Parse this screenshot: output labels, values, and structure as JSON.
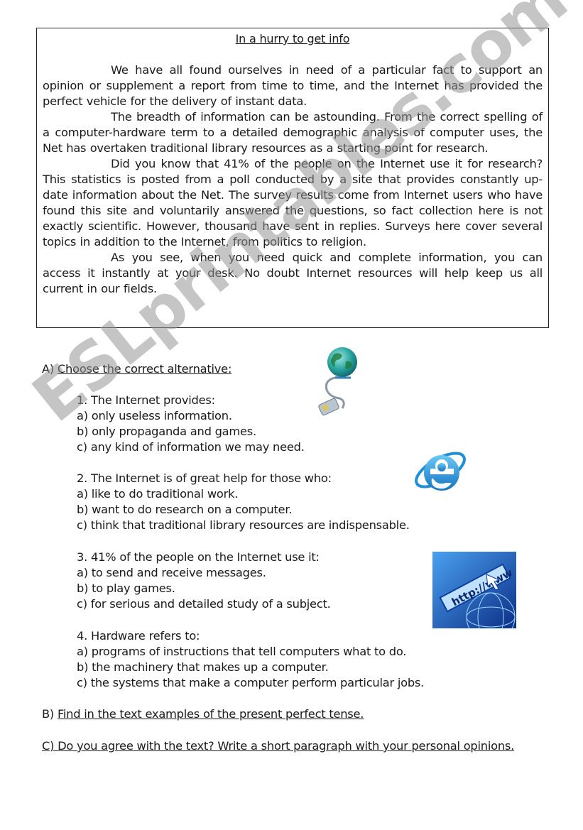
{
  "reading": {
    "title": "In a hurry to get info",
    "paragraphs": [
      "We have all found ourselves in need of a particular fact to support an opinion or supplement a report from time to time, and the Internet has provided the perfect vehicle for the delivery of instant data.",
      "The breadth of information can be astounding. From the correct spelling of a computer-hardware term to a detailed demographic analysis of computer uses, the Net has overtaken traditional library resources as a starting point for research.",
      "Did you know that 41% of the people on the Internet use it for research? This statistics is posted from a poll conducted by a site that provides constantly up-date information about the Net. The survey results come from Internet users who have found this site and voluntarily answered the questions, so fact collection here is not exactly scientific. However, thousand have sent in replies. Surveys here cover several topics in addition to the Internet, from politics to religion.",
      "As you see, when you need quick and complete information, you can access it instantly at your desk. No doubt Internet resources will help keep us all current in our fields."
    ]
  },
  "section_a": {
    "prefix": "A) ",
    "heading": "Choose the correct alternative:",
    "questions": [
      {
        "stem": "1. The Internet provides:",
        "options": [
          "a) only useless information.",
          "b) only propaganda and games.",
          "c) any kind of information we may need."
        ]
      },
      {
        "stem": "2. The Internet is of great help for those who:",
        "options": [
          "a) like to do traditional work.",
          "b) want to do research on a computer.",
          "c)  think that traditional library resources are indispensable."
        ]
      },
      {
        "stem": "3. 41% of the people on the Internet use it:",
        "options": [
          "a)  to send and receive messages.",
          "b)  to play games.",
          "c)  for serious and detailed study of a subject."
        ]
      },
      {
        "stem": "4. Hardware refers to:",
        "options": [
          "a)  programs of instructions that tell computers what to do.",
          "b)  the machinery that makes up a computer.",
          "c)  the systems that make a computer perform particular jobs."
        ]
      }
    ]
  },
  "section_b": {
    "prefix": "B)  ",
    "text": "Find in the text examples of the present perfect tense."
  },
  "section_c": {
    "text": "C) Do you agree with the text? Write a short paragraph with your personal opinions."
  },
  "images": {
    "globe": "globe-with-network-cable-icon",
    "ie": "internet-explorer-logo-icon",
    "http": "http-www-browser-address-icon",
    "http_text": "http://www"
  },
  "watermark": "ESLprintables.com",
  "colors": {
    "text": "#1a1a1a",
    "ie_blue": "#1e8fd6",
    "globe_teal": "#2aa7a0",
    "http_blue": "#1d5fc2",
    "watermark": "#969696"
  }
}
